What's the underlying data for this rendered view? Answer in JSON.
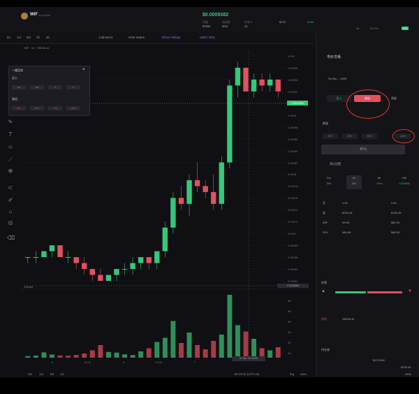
{
  "header": {
    "token_name": "WIF",
    "token_sub": "dogwifhat",
    "price": "$0.0009382",
    "stats": [
      {
        "label": "市值",
        "value": "$750K"
      },
      {
        "label": "流动性",
        "value": "$7M"
      },
      {
        "label": "持有人",
        "value": "24"
      },
      {
        "label": "",
        "value": "$770"
      },
      {
        "label": "",
        "value": "4.6%"
      }
    ],
    "right_stats": [
      "1h",
      "25.2%",
      "4.6"
    ]
  },
  "toolbar": {
    "intervals": [
      "5s",
      "1m",
      "5m",
      "1h",
      "4h"
    ],
    "indicators": "Indicators",
    "hide_trades": "Hide trades",
    "price_mcap": "Price / MCap",
    "usd_sol": "USD / SOL"
  },
  "chart": {
    "ohlc_label": "WIF · 1h · GMGN.AI",
    "volume_label": "Volume",
    "current_price": "0.0009382",
    "crosshair_price": "0.0004566",
    "crosshair_date": "07 Nov '24 19:00",
    "y_ticks": [
      "0.001",
      "0.00098",
      "0.00096",
      "0.00094",
      "0.00092",
      "0.0009",
      "0.00088",
      "0.00086",
      "0.00084",
      "0.00082",
      "0.0008",
      "0.00078",
      "0.00076",
      "0.00074",
      "0.00072",
      "0.0007",
      "0.00068",
      "0.00066",
      "0.00064",
      "0.00062"
    ],
    "vol_ticks": [
      "6K",
      "5K",
      "4K",
      "3K",
      "2K",
      "1K"
    ],
    "x_ticks": [
      "6",
      "12:00",
      "6",
      "12:00",
      "7"
    ],
    "time_display": "19:10:32 (UTC+8)",
    "bottom_ranges": [
      "3m",
      "1m",
      "5d",
      "1d"
    ],
    "log": "log",
    "auto": "auto"
  },
  "popup": {
    "title": "一键买卖",
    "buy_label": "买入",
    "buy_amounts": [
      "0.1",
      "0.5",
      "1",
      "2"
    ],
    "sell_label": "卖出",
    "sell_amounts": [
      "25%",
      "50%",
      "75%",
      "100%"
    ]
  },
  "chart_data": {
    "type": "candlestick",
    "title": "",
    "xlabel": "",
    "ylabel": "",
    "ylim": [
      0.00062,
      0.001
    ],
    "ohlc": [
      [
        0.00066,
        0.00066,
        0.00065,
        0.00066
      ],
      [
        0.00066,
        0.00067,
        0.00065,
        0.00066
      ],
      [
        0.00066,
        0.00067,
        0.00066,
        0.00067
      ],
      [
        0.00067,
        0.00068,
        0.00066,
        0.00068
      ],
      [
        0.00068,
        0.00068,
        0.00066,
        0.00066
      ],
      [
        0.00066,
        0.00067,
        0.00065,
        0.00066
      ],
      [
        0.00066,
        0.00066,
        0.00064,
        0.00065
      ],
      [
        0.00065,
        0.00066,
        0.00063,
        0.00064
      ],
      [
        0.00064,
        0.00064,
        0.00062,
        0.00063
      ],
      [
        0.00063,
        0.00064,
        0.00062,
        0.00062
      ],
      [
        0.00062,
        0.00063,
        0.00062,
        0.00063
      ],
      [
        0.00063,
        0.00064,
        0.00062,
        0.00064
      ],
      [
        0.00064,
        0.00065,
        0.00063,
        0.00064
      ],
      [
        0.00064,
        0.00066,
        0.00063,
        0.00065
      ],
      [
        0.00065,
        0.00066,
        0.00064,
        0.00066
      ],
      [
        0.00066,
        0.00066,
        0.00064,
        0.00065
      ],
      [
        0.00065,
        0.00067,
        0.00064,
        0.00067
      ],
      [
        0.00067,
        0.00072,
        0.00066,
        0.00071
      ],
      [
        0.00071,
        0.00077,
        0.0007,
        0.00076
      ],
      [
        0.00076,
        0.00078,
        0.00074,
        0.00075
      ],
      [
        0.00075,
        0.0008,
        0.00073,
        0.00079
      ],
      [
        0.00079,
        0.00082,
        0.00077,
        0.00078
      ],
      [
        0.00078,
        0.00079,
        0.00076,
        0.00077
      ],
      [
        0.00077,
        0.0008,
        0.00074,
        0.00075
      ],
      [
        0.00075,
        0.00083,
        0.00074,
        0.00082
      ],
      [
        0.00082,
        0.00096,
        0.00081,
        0.00095
      ],
      [
        0.00095,
        0.00099,
        0.00093,
        0.00098
      ],
      [
        0.00098,
        0.00098,
        0.00094,
        0.00094
      ],
      [
        0.00094,
        0.00097,
        0.00093,
        0.00096
      ],
      [
        0.00096,
        0.00097,
        0.00094,
        0.00095
      ],
      [
        0.00095,
        0.00097,
        0.00094,
        0.00096
      ],
      [
        0.00096,
        0.00096,
        0.00093,
        0.00094
      ]
    ],
    "volume": [
      150,
      200,
      500,
      300,
      220,
      180,
      260,
      400,
      700,
      1200,
      550,
      480,
      320,
      250,
      600,
      900,
      1500,
      1900,
      3500,
      1400,
      2400,
      1200,
      800,
      1600,
      2200,
      6000,
      3100,
      2500,
      1800,
      900,
      700,
      1000
    ],
    "vol_colors_up": [
      true,
      true,
      true,
      true,
      false,
      false,
      false,
      false,
      false,
      false,
      true,
      true,
      true,
      true,
      true,
      false,
      true,
      true,
      true,
      false,
      true,
      false,
      false,
      false,
      true,
      true,
      true,
      false,
      true,
      false,
      true,
      false
    ]
  },
  "right": {
    "title": "市价交易",
    "wallet": "Sol Ba..., 0000",
    "buy": "买入",
    "sell": "卖出",
    "advanced": "高级",
    "amount_label": "数量",
    "amounts": [
      "10%",
      "25%",
      "50%",
      "100%"
    ],
    "sell_button": "卖出",
    "slippage": "滑点设置",
    "tf": [
      {
        "label": "5m",
        "value": "0%"
      },
      {
        "label": "1h",
        "value": "0%"
      },
      {
        "label": "6h",
        "value": "-99%"
      },
      {
        "label": "24h",
        "value": "+25.69%"
      }
    ],
    "rows": [
      {
        "label": "买",
        "a": "0.00",
        "b": "0.00"
      },
      {
        "label": "卖",
        "a": "$750.46",
        "b": "$750.46"
      },
      {
        "label": "WIF",
        "a": "95.4K",
        "b": "$50.34"
      },
      {
        "label": "SOL",
        "a": "480.9K",
        "b": "$58.30"
      }
    ],
    "sentiment_label": "投票",
    "comments_label": "评论",
    "about_label": "GMGN.AI",
    "holder_label": "持仓者",
    "holder_value": "$179.54K",
    "holder_value2": "$750.46",
    "holder_value3": "2451"
  }
}
